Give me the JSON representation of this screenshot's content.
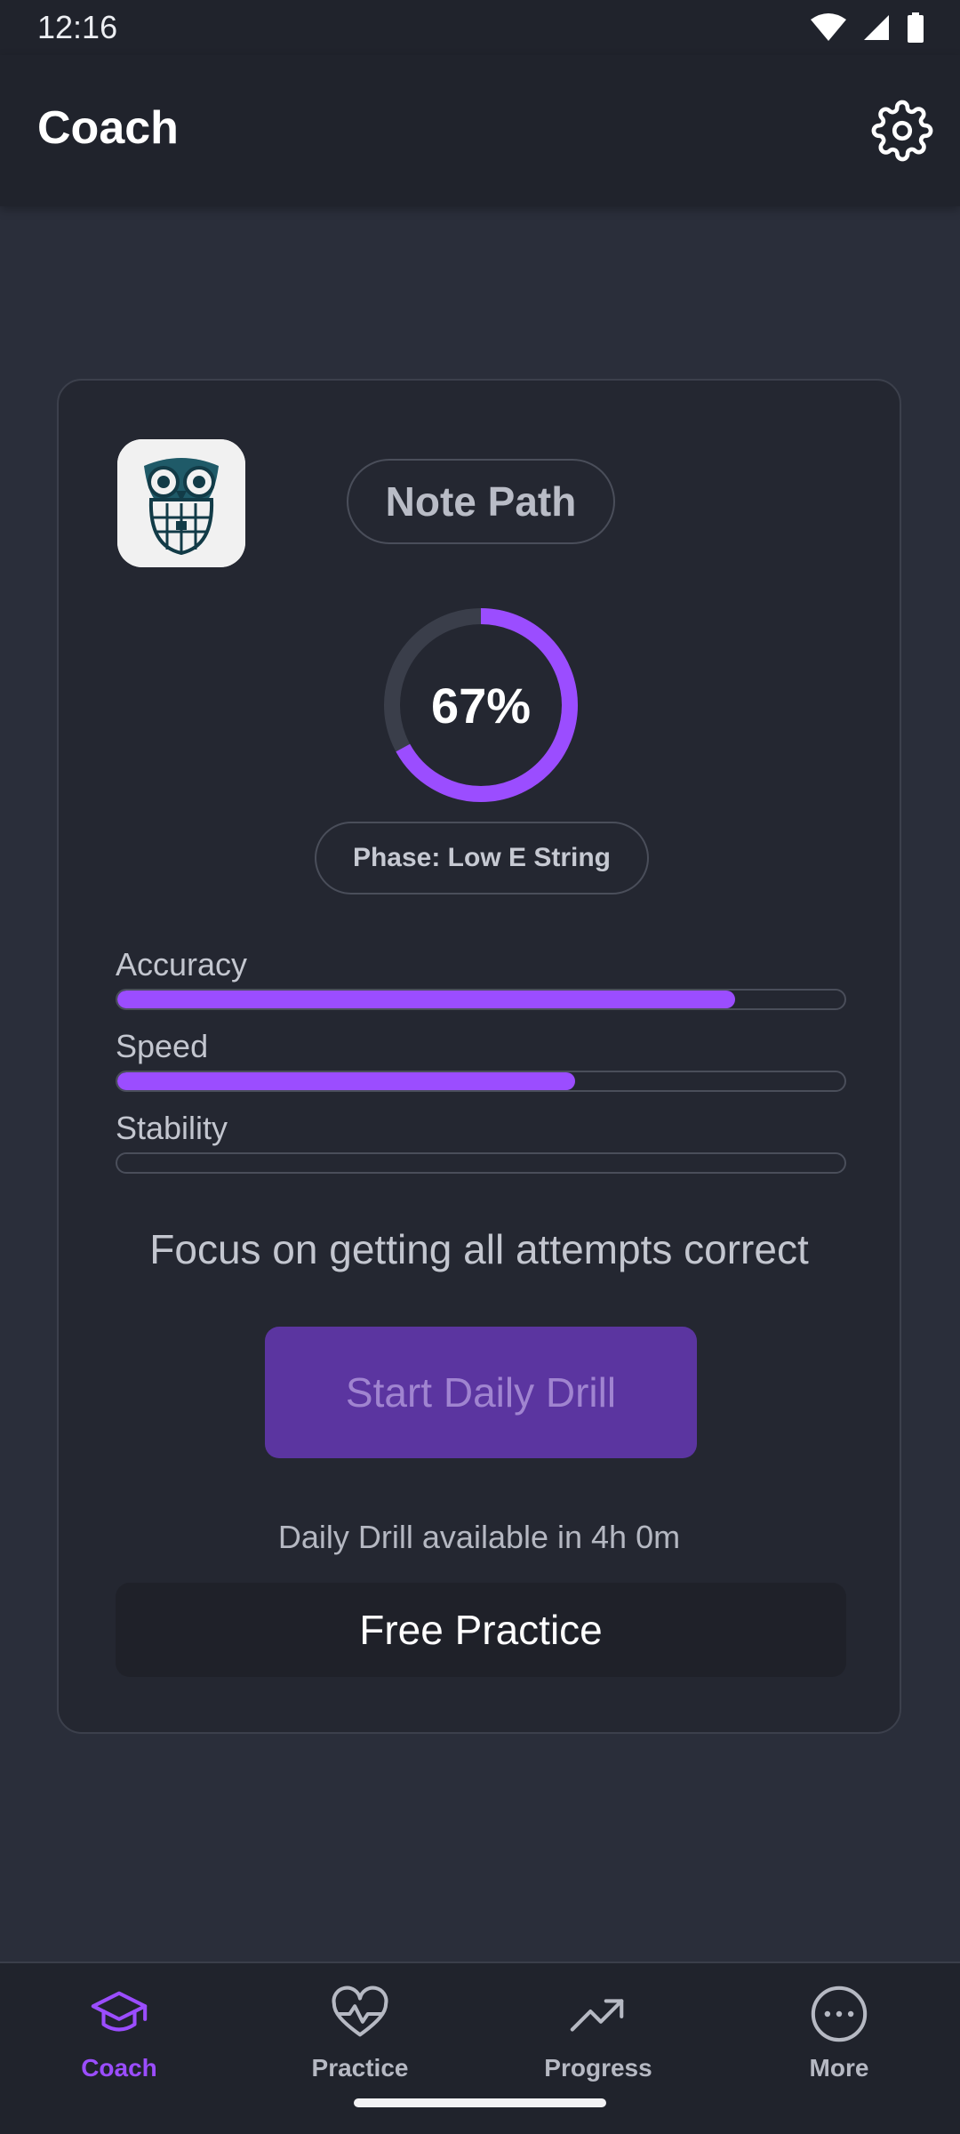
{
  "status_bar": {
    "time": "12:16"
  },
  "app_bar": {
    "title": "Coach"
  },
  "card": {
    "path_name": "Note Path",
    "progress": {
      "label": "67%",
      "value": 0.67
    },
    "phase": "Phase: Low E String",
    "metrics": [
      {
        "label": "Accuracy",
        "value": 0.85
      },
      {
        "label": "Speed",
        "value": 0.63
      },
      {
        "label": "Stability",
        "value": 0.0
      }
    ],
    "focus_text": "Focus on getting all attempts correct",
    "start_button": "Start Daily Drill",
    "availability_text": "Daily Drill available in 4h 0m",
    "free_practice_button": "Free Practice"
  },
  "bottom_nav": {
    "items": [
      {
        "label": "Coach",
        "icon": "graduation-cap-icon",
        "active": true
      },
      {
        "label": "Practice",
        "icon": "heart-pulse-icon",
        "active": false
      },
      {
        "label": "Progress",
        "icon": "trending-up-icon",
        "active": false
      },
      {
        "label": "More",
        "icon": "more-horizontal-icon",
        "active": false
      }
    ]
  },
  "colors": {
    "accent": "#9b4dff",
    "background": "#2a2e3a",
    "surface": "#242731",
    "bar": "#20232c"
  }
}
